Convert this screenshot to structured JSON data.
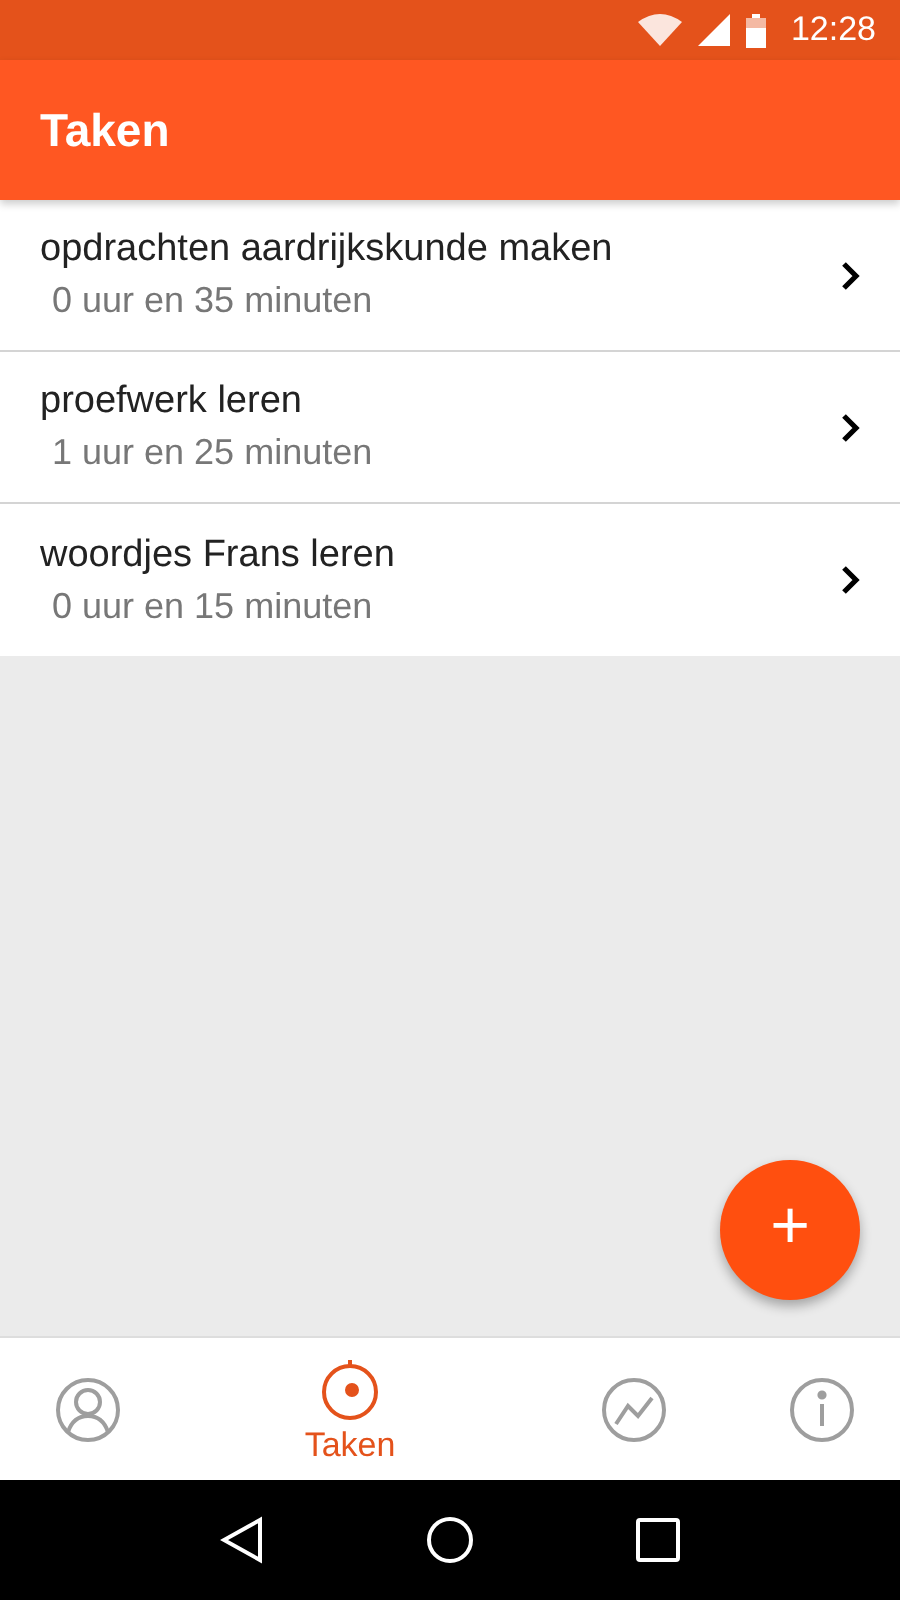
{
  "status_bar": {
    "time": "12:28"
  },
  "app_bar": {
    "title": "Taken"
  },
  "tasks": [
    {
      "name": "opdrachten aardrijkskunde maken",
      "duration": "0 uur en 35 minuten"
    },
    {
      "name": "proefwerk leren",
      "duration": "1 uur en 25 minuten"
    },
    {
      "name": "woordjes Frans leren",
      "duration": "0 uur en 15 minuten"
    }
  ],
  "fab": {
    "label": "+"
  },
  "bottom_nav": [
    {
      "kind": "profile",
      "selected": false
    },
    {
      "kind": "timer",
      "selected": true,
      "label": "Taken"
    },
    {
      "kind": "chart",
      "selected": false
    },
    {
      "kind": "info",
      "selected": false
    }
  ]
}
